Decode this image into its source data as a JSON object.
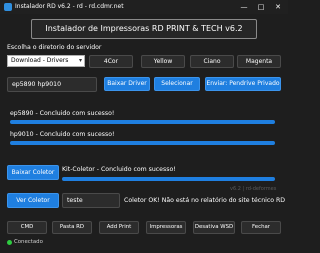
{
  "window": {
    "title": "Instalador RD v6.2 - rd - rd.cdmr.net",
    "controls": {
      "minimize": "—",
      "maximize": "□",
      "close": "✕"
    }
  },
  "header": {
    "title": "Instalador de Impressoras RD PRINT & TECH v6.2"
  },
  "directory": {
    "label": "Escolha o diretorio do servidor",
    "selected": "Download - Drivers"
  },
  "color_buttons": [
    "4Cor",
    "Yellow",
    "Ciano",
    "Magenta"
  ],
  "printers_input": {
    "value": "ep5890 hp9010"
  },
  "actions": {
    "baixar_driver": "Baixar Driver",
    "selecionar": "Selecionar",
    "enviar": "Enviar: Pendrive Privado"
  },
  "status": [
    {
      "text": "ep5890 - Concluido com sucesso!",
      "progress": 1.0
    },
    {
      "text": "hp9010 - Concluido com sucesso!",
      "progress": 1.0
    }
  ],
  "coletor": {
    "baixar_label": "Baixar Coletor",
    "kit_status": "Kit-Coletor - Concluido com sucesso!",
    "kit_progress": 1.0,
    "ver_label": "Ver Coletor",
    "name_value": "teste",
    "message": "Coletor OK! Não está no relatório do site técnico RD",
    "footer": "v6.2 | rd-deformes"
  },
  "bottom_buttons": {
    "cmd": "CMD",
    "pasta_rd": "Pasta RD",
    "add_print": "Add Print",
    "impressoras": "Impressoras",
    "desativa_wsd": "Desativa WSD",
    "fechar": "Fechar"
  },
  "connection": {
    "status": "Conectado",
    "color": "#2ecc40"
  },
  "accent_color": "#1f7fe0"
}
